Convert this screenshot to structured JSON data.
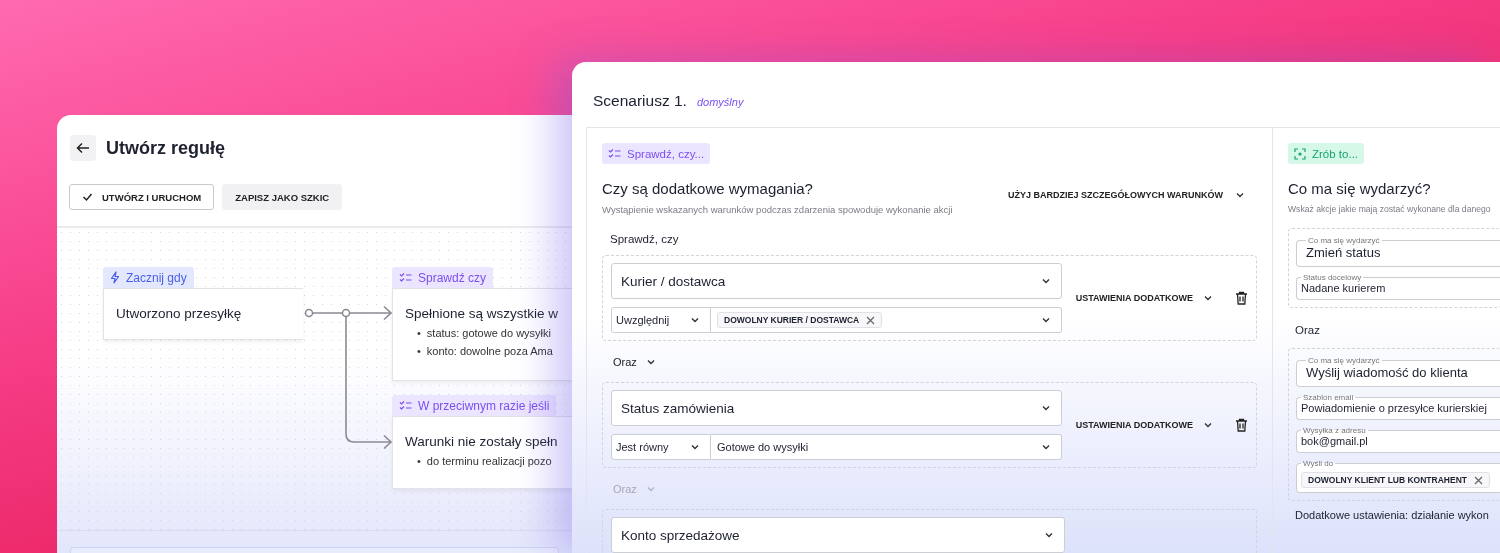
{
  "rule_editor": {
    "title": "Utwórz regułę",
    "buttons": [
      {
        "label": "UTWÓRZ I URUCHOM",
        "kind": "primary"
      },
      {
        "label": "ZAPISZ JAKO SZKIC",
        "kind": "secondary"
      }
    ],
    "nodes": [
      {
        "kind": "trigger",
        "tag": "Zacznij gdy",
        "title": "Utworzono przesyłkę"
      },
      {
        "kind": "condition",
        "tag": "Sprawdź czy",
        "title": "Spełnione są wszystkie w",
        "bullet_marker": "•",
        "bullets": [
          "status: gotowe do wysyłki",
          "konto: dowolne poza Ama"
        ]
      },
      {
        "kind": "condition",
        "tag": "W przeciwnym razie jeśli",
        "title": "Warunki nie zostały spełn",
        "bullet_marker": "•",
        "bullets": [
          "do terminu realizacji pozo"
        ]
      }
    ]
  },
  "scenario": {
    "title": "Scenariusz 1.",
    "badge": "domyślny",
    "conditions": {
      "tag": "Sprawdź, czy...",
      "heading": "Czy są dodatkowe wymagania?",
      "description": "Wystąpienie wskazanych warunków podczas zdarzenia spowoduje wykonanie akcji",
      "toggle": "UŻYJ BARDZIEJ SZCZEGÓŁOWYCH WARUNKÓW",
      "label": "Sprawdź, czy",
      "groups": [
        {
          "field": "Kurier / dostawca",
          "operator": "Uwzględnij",
          "chips": [
            "DOWOLNY KURIER / DOSTAWCA"
          ],
          "settings": "USTAWIENIA DODATKOWE"
        },
        {
          "field": "Status zamówienia",
          "operator": "Jest równy",
          "value": "Gotowe do wysyłki",
          "settings": "USTAWIENIA DODATKOWE"
        },
        {
          "field": "Konto sprzedażowe"
        }
      ],
      "connectors": [
        {
          "label": "Oraz",
          "disabled": false
        },
        {
          "label": "Oraz",
          "disabled": true
        }
      ]
    },
    "actions": {
      "tag": "Zrób to...",
      "heading": "Co ma się wydarzyć?",
      "description": "Wskaż akcje jakie mają zostać wykonane dla danego",
      "groups": [
        {
          "fields": [
            {
              "kind": "action",
              "label": "Co ma się wydarzyć",
              "value": "Zmień status"
            },
            {
              "kind": "text",
              "label": "Status docelowy",
              "value": "Nadane kurierem"
            }
          ]
        },
        {
          "fields": [
            {
              "kind": "action",
              "label": "Co ma się wydarzyć",
              "value": "Wyślij wiadomość do klienta"
            },
            {
              "kind": "text",
              "label": "Szablon email",
              "value": "Powiadomienie o przesyłce kurierskiej"
            },
            {
              "kind": "text",
              "label": "Wysyłka z adresu",
              "value": "bok@gmail.pl"
            },
            {
              "kind": "chips",
              "label": "Wyśli do",
              "chips": [
                "DOWOLNY KLIENT LUB KONTRAHENT"
              ]
            }
          ]
        }
      ],
      "connectors": [
        {
          "label": "Oraz"
        }
      ],
      "footer": "Dodatkowe ustawienia: działanie wykon"
    }
  }
}
